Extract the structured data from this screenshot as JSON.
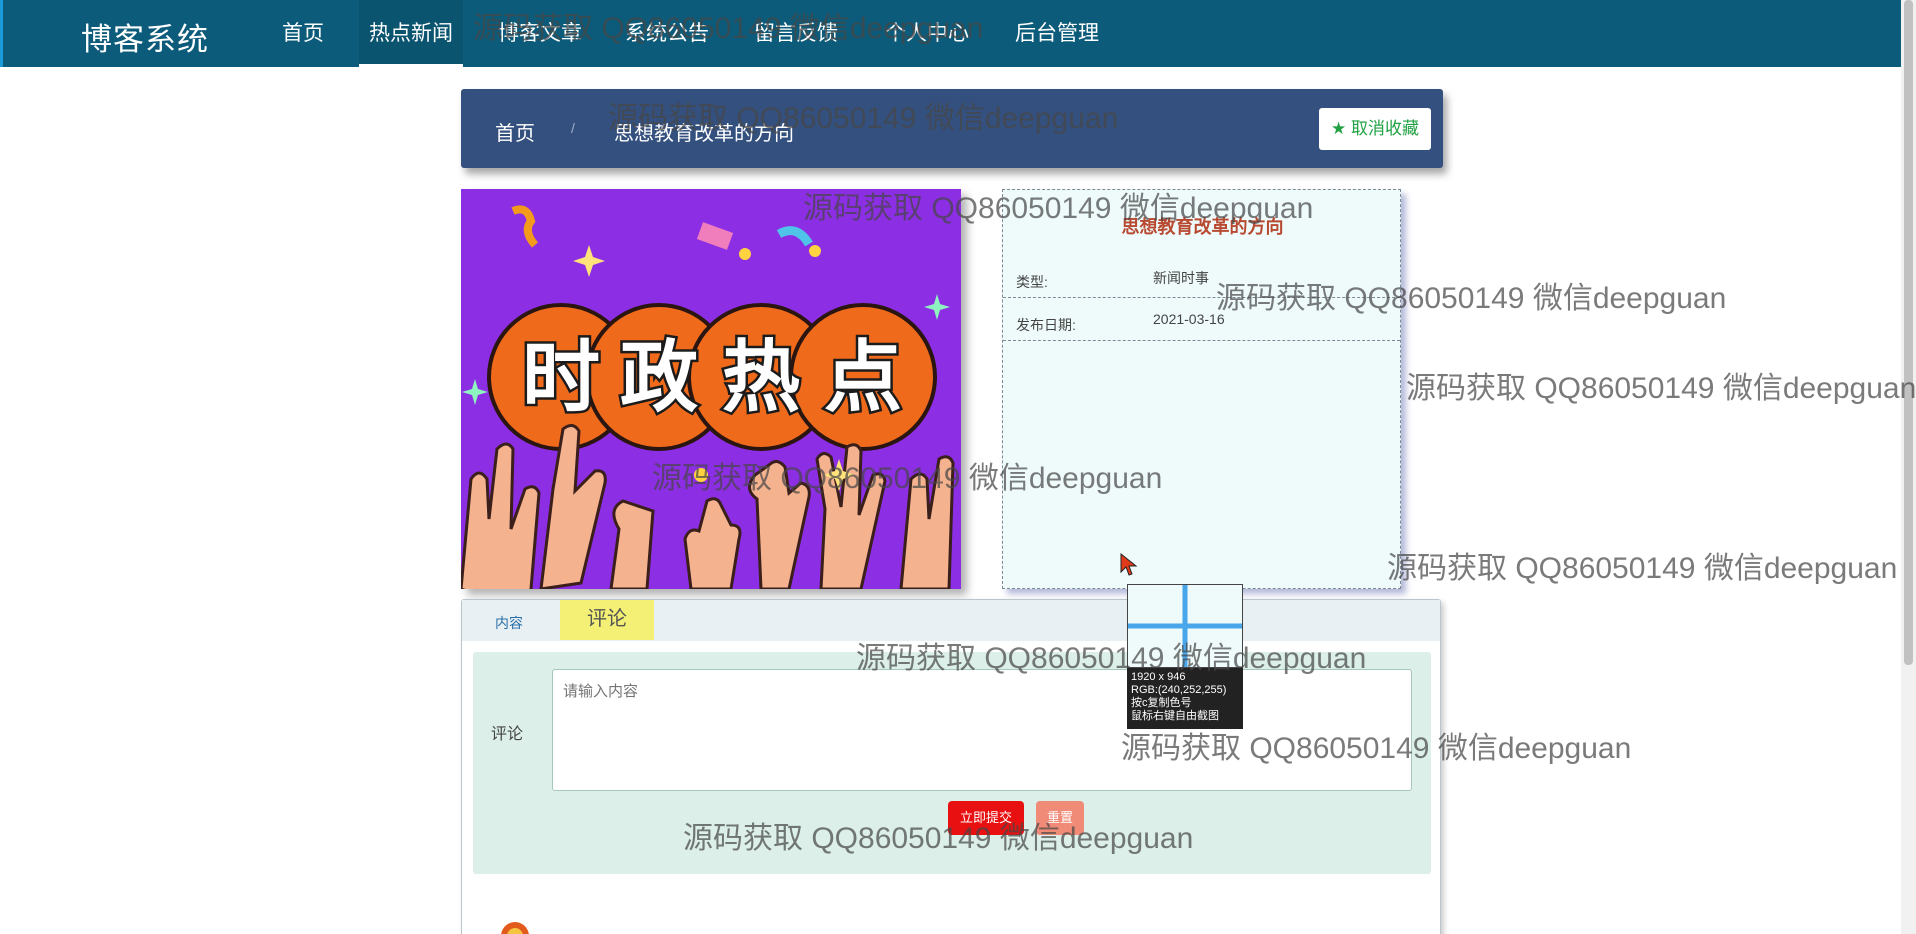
{
  "brand": "博客系统",
  "nav": [
    "首页",
    "热点新闻",
    "博客文章",
    "系统公告",
    "留言反馈",
    "个人中心",
    "后台管理"
  ],
  "breadcrumb": {
    "home": "首页",
    "sep": "/",
    "current": "思想教育改革的方向"
  },
  "favorite_button": "取消收藏",
  "hero": {
    "text_chars": [
      "时",
      "政",
      "热",
      "点"
    ]
  },
  "info": {
    "title": "思想教育改革的方向",
    "type_label": "类型:",
    "type_value": "新闻时事",
    "date_label": "发布日期:",
    "date_value": "2021-03-16"
  },
  "tabs": {
    "content": "内容",
    "comment": "评论"
  },
  "comment_form": {
    "label": "评论",
    "placeholder": "请输入内容",
    "submit": "立即提交",
    "reset": "重置"
  },
  "color_picker": {
    "size": "1920 x 946",
    "rgb": "RGB:(240,252,255)",
    "hint1": "按c复制色号",
    "hint2": "鼠标右键自由截图"
  },
  "watermark": "源码获取 QQ86050149 微信deepguan",
  "colors": {
    "nav_bg": "#0c5b7a",
    "crumb_bg": "#34507f",
    "hero_bg": "#8c2ee3",
    "submit": "#e81010",
    "reset": "#f08b78"
  }
}
